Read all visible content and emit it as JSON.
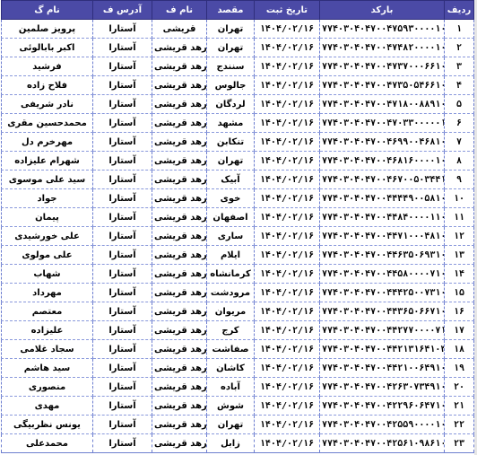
{
  "columns": {
    "name": "نام گ",
    "address": "آدرس ف",
    "sender": "نام ف",
    "destination": "مقصد",
    "date": "تاریخ ثبت",
    "barcode": "بارکد",
    "row": "ردیف"
  },
  "rows": [
    {
      "name": "پرویز صلمین",
      "address": "آستارا",
      "sender": "قریشی",
      "destination": "تهران",
      "date": "۱۴۰۴/۰۲/۱۶",
      "barcode": "۷۷۴۰۳۰۴۰۴۷۰۰۴۷۵۹۳۰۰۰۰۱۰۴",
      "row": "۱"
    },
    {
      "name": "اکبر بابالوئی",
      "address": "آستارا",
      "sender": "فرهد قریشی",
      "destination": "تهران",
      "date": "۱۴۰۴/۰۲/۱۶",
      "barcode": "۷۷۴۰۳۰۴۰۴۷۰۰۴۷۴۸۲۰۰۰۰۱۰۴",
      "row": "۲"
    },
    {
      "name": "فرشید",
      "address": "آستارا",
      "sender": "فرهد قریشی",
      "destination": "سنندج",
      "date": "۱۴۰۴/۰۲/۱۶",
      "barcode": "۷۷۴۰۳۰۴۰۴۷۰۰۴۷۳۷۰۰۰۶۶۱۰۴",
      "row": "۳"
    },
    {
      "name": "فلاح زاده",
      "address": "آستارا",
      "sender": "فرهد قریشی",
      "destination": "جالوس",
      "date": "۱۴۰۴/۰۲/۱۶",
      "barcode": "۷۷۴۰۳۰۴۰۴۷۰۰۴۷۳۵۰۵۴۶۶۱۰۴",
      "row": "۴"
    },
    {
      "name": "نادر شریفی",
      "address": "آستارا",
      "sender": "فرهد قریشی",
      "destination": "لردگان",
      "date": "۱۴۰۴/۰۲/۱۶",
      "barcode": "۷۷۴۰۳۰۴۰۴۷۰۰۴۷۱۸۰۰۸۸۹۱۰۴",
      "row": "۵"
    },
    {
      "name": "محمدحسین مقری",
      "address": "آستارا",
      "sender": "فرهد قریشی",
      "destination": "مشهد",
      "date": "۱۴۰۴/۰۲/۱۶",
      "barcode": "۷۷۴۰۳۰۴۰۴۷۰۰۴۷۰۳۳۰۰۰۰۰۱۰۴",
      "row": "۶"
    },
    {
      "name": "مهرخرم دل",
      "address": "آستارا",
      "sender": "فرهد قریشی",
      "destination": "تنکابن",
      "date": "۱۴۰۴/۰۲/۱۶",
      "barcode": "۷۷۴۰۳۰۴۰۴۷۰۰۴۶۹۹۰۰۴۶۸۱۰۴",
      "row": "۷"
    },
    {
      "name": "شهرام علیزاده",
      "address": "آستارا",
      "sender": "فرهد قریشی",
      "destination": "تهران",
      "date": "۱۴۰۴/۰۲/۱۶",
      "barcode": "۷۷۴۰۳۰۴۰۴۷۰۰۴۶۸۱۶۰۰۰۰۱۰۴",
      "row": "۸"
    },
    {
      "name": "سید علی موسوی",
      "address": "آستارا",
      "sender": "فرهد قریشی",
      "destination": "آبیک",
      "date": "۱۴۰۴/۰۲/۱۶",
      "barcode": "۷۷۴۰۳۰۴۰۴۷۰۰۴۶۷۰۰۵۰۳۴۴۱۰۴",
      "row": "۹"
    },
    {
      "name": "جواد",
      "address": "آستارا",
      "sender": "فرهد قریشی",
      "destination": "خوی",
      "date": "۱۴۰۴/۰۲/۱۶",
      "barcode": "۷۷۴۰۳۰۴۰۴۷۰۰۴۴۴۴۹۰۰۵۸۱۰۴",
      "row": "۱۰"
    },
    {
      "name": "پیمان",
      "address": "آستارا",
      "sender": "فرهد قریشی",
      "destination": "اصفهان",
      "date": "۱۴۰۴/۰۲/۱۶",
      "barcode": "۷۷۴۰۳۰۴۰۴۷۰۰۴۴۸۴۰۰۰۰۱۱۰۴",
      "row": "۱۱"
    },
    {
      "name": "علی خورشیدی",
      "address": "آستارا",
      "sender": "فرهد قریشی",
      "destination": "ساری",
      "date": "۱۴۰۴/۰۲/۱۶",
      "barcode": "۷۷۴۰۳۰۴۰۴۷۰۰۴۴۷۱۰۰۰۴۸۱۰۴",
      "row": "۱۲"
    },
    {
      "name": "علی مولوی",
      "address": "آستارا",
      "sender": "فرهد قریشی",
      "destination": "ایلام",
      "date": "۱۴۰۴/۰۲/۱۶",
      "barcode": "۷۷۴۰۳۰۴۰۴۷۰۰۴۴۶۳۵۰۶۹۳۱۰۴",
      "row": "۱۳"
    },
    {
      "name": "شهاب",
      "address": "آستارا",
      "sender": "فرهد قریشی",
      "destination": "کرمانشاه",
      "date": "۱۴۰۴/۰۲/۱۶",
      "barcode": "۷۷۴۰۳۰۴۰۴۷۰۰۴۴۵۸۰۰۰۰۷۱۰۴",
      "row": "۱۴"
    },
    {
      "name": "مهرداد",
      "address": "آستارا",
      "sender": "فرهد قریشی",
      "destination": "مرودشت",
      "date": "۱۴۰۴/۰۲/۱۶",
      "barcode": "۷۷۴۰۳۰۴۰۴۷۰۰۴۴۴۲۵۰۰۷۳۱۰۴",
      "row": "۱۵"
    },
    {
      "name": "معتصم",
      "address": "آستارا",
      "sender": "فرهد قریشی",
      "destination": "مریوان",
      "date": "۱۴۰۴/۰۲/۱۶",
      "barcode": "۷۷۴۰۳۰۴۰۴۷۰۰۴۴۳۶۵۰۶۶۷۱۰۴",
      "row": "۱۶"
    },
    {
      "name": "علیزاده",
      "address": "آستارا",
      "sender": "فرهد قریشی",
      "destination": "کرج",
      "date": "۱۴۰۴/۰۲/۱۶",
      "barcode": "۷۷۴۰۳۰۴۰۴۷۰۰۴۴۲۷۷۰۰۰۰۷۱۰۴",
      "row": "۱۷"
    },
    {
      "name": "سجاد غلامی",
      "address": "آستارا",
      "sender": "فرهد قریشی",
      "destination": "صفاشت",
      "date": "۱۴۰۴/۰۲/۱۶",
      "barcode": "۷۷۴۰۳۰۴۰۴۷۰۰۴۴۲۱۳۱۶۴۱۰۴",
      "row": "۱۸"
    },
    {
      "name": "سید هاشم",
      "address": "آستارا",
      "sender": "فرهد قریشی",
      "destination": "کاشان",
      "date": "۱۴۰۴/۰۲/۱۶",
      "barcode": "۷۷۴۰۳۰۴۰۴۷۰۰۴۴۲۱۰۰۶۴۹۱۰۴",
      "row": "۱۹"
    },
    {
      "name": "منصوری",
      "address": "آستارا",
      "sender": "فرهد قریشی",
      "destination": "آباده",
      "date": "۱۴۰۴/۰۲/۱۶",
      "barcode": "۷۷۴۰۳۰۴۰۴۷۰۰۴۲۶۳۰۷۳۴۹۱۰۴",
      "row": "۲۰"
    },
    {
      "name": "مهدی",
      "address": "آستارا",
      "sender": "فرهد قریشی",
      "destination": "شوش",
      "date": "۱۴۰۴/۰۲/۱۶",
      "barcode": "۷۷۴۰۳۰۴۰۴۷۰۰۴۲۲۹۶۰۶۴۷۱۰۴",
      "row": "۲۱"
    },
    {
      "name": "یونس نظربیگی",
      "address": "آستارا",
      "sender": "فرهد قریشی",
      "destination": "تهران",
      "date": "۱۴۰۴/۰۲/۱۶",
      "barcode": "۷۷۴۰۳۰۴۰۴۷۰۰۴۲۵۵۹۰۰۰۰۱۰۴",
      "row": "۲۲"
    },
    {
      "name": "محمدعلی",
      "address": "آستارا",
      "sender": "فرهد قریشی",
      "destination": "زابل",
      "date": "۱۴۰۴/۰۲/۱۶",
      "barcode": "۷۷۴۰۳۰۴۰۴۷۰۰۴۲۵۶۱۰۹۸۶۱۰۴",
      "row": "۲۳"
    }
  ]
}
